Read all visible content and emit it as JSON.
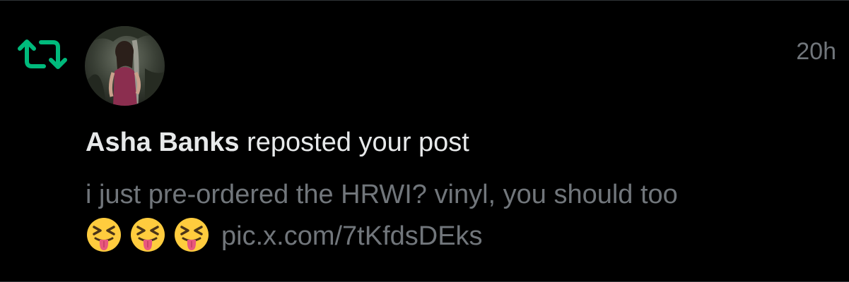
{
  "notification": {
    "type_icon": "repost-icon",
    "accent_color": "#00ba7c",
    "timestamp": "20h",
    "user_name": "Asha Banks",
    "action_text": "reposted your post",
    "post": {
      "text": "i just pre-ordered the HRWI? vinyl, you should too",
      "emojis": [
        "😝",
        "😝",
        "😝"
      ],
      "link": "pic.x.com/7tKfdsDEks"
    }
  }
}
